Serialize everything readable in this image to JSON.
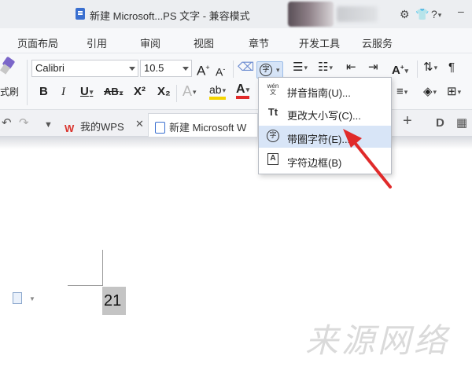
{
  "titlebar": {
    "title": "新建 Microsoft...PS 文字 - 兼容模式",
    "icons": [
      "doc-icon",
      "user-avatar",
      "settings-icon",
      "shirt-skin-icon",
      "help-icon",
      "minimize-icon"
    ]
  },
  "menu": {
    "tabs": [
      "页面布局",
      "引用",
      "审阅",
      "视图",
      "章节",
      "开发工具",
      "云服务"
    ]
  },
  "ribbon": {
    "format_painter_label": "式刷",
    "font_name": "Calibri",
    "font_size": "10.5",
    "grow_font": "A",
    "shrink_font": "A",
    "bold": "B",
    "italic": "I",
    "underline": "U",
    "strikethrough": "AB",
    "superscript": "X²",
    "subscript": "X₂",
    "text_effect": "A",
    "highlight": "ab",
    "font_color": "A",
    "circle_char_glyph": "字"
  },
  "dropdown": {
    "items": [
      {
        "icon": "pinyin-guide-icon",
        "glyph": "wén 文",
        "label": "拼音指南(U)..."
      },
      {
        "icon": "change-case-icon",
        "glyph": "Tt",
        "label": "更改大小写(C)..."
      },
      {
        "icon": "enclosed-char-icon",
        "glyph": "字",
        "label": "带圈字符(E)..."
      },
      {
        "icon": "char-border-icon",
        "glyph": "A",
        "label": "字符边框(B)"
      }
    ],
    "highlighted_index": 2
  },
  "tabs": {
    "wps_tab": "我的WPS",
    "doc_tab": "新建 Microsoft W"
  },
  "document": {
    "selected_text": "21"
  },
  "watermark": "来源网络",
  "colors": {
    "accent_highlight": "#d8e5f7",
    "arrow_red": "#e02a2a",
    "font_color_underline": "#e02a2a",
    "highlight_yellow": "#f5d400"
  }
}
